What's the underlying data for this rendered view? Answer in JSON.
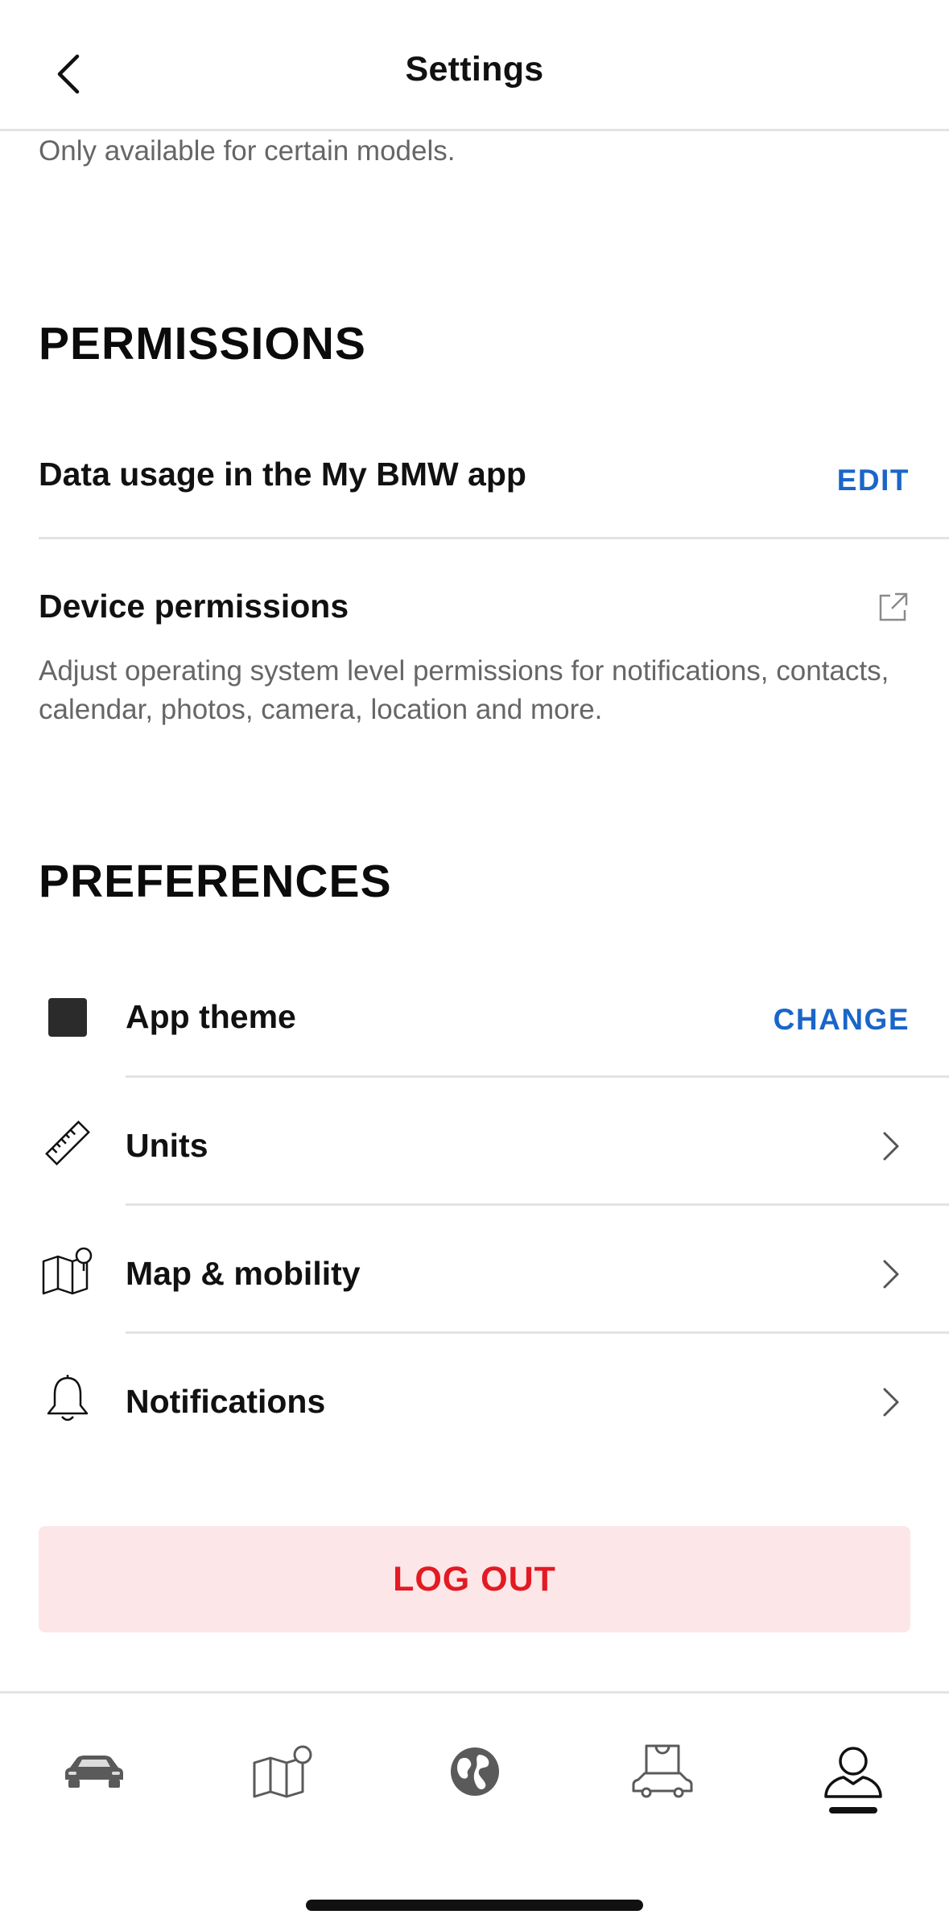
{
  "header": {
    "title": "Settings",
    "back_icon": "chevron-left-icon"
  },
  "note_text": "Only available for certain models.",
  "permissions": {
    "heading": "PERMISSIONS",
    "data_usage": {
      "title": "Data usage in the My BMW app",
      "action": "EDIT"
    },
    "device_permissions": {
      "title": "Device permissions",
      "description": "Adjust operating system level permissions for notifications, contacts, calendar, photos, camera, location and more.",
      "icon": "external-link-icon"
    }
  },
  "preferences": {
    "heading": "PREFERENCES",
    "items": [
      {
        "icon": "theme-swatch-icon",
        "label": "App theme",
        "action": "CHANGE"
      },
      {
        "icon": "ruler-icon",
        "label": "Units",
        "trailing_icon": "chevron-right-icon"
      },
      {
        "icon": "map-pin-icon",
        "label": "Map & mobility",
        "trailing_icon": "chevron-right-icon"
      },
      {
        "icon": "bell-icon",
        "label": "Notifications",
        "trailing_icon": "chevron-right-icon"
      }
    ]
  },
  "logout_label": "LOG OUT",
  "tabbar": {
    "tabs": [
      {
        "name": "vehicle",
        "icon": "car-icon"
      },
      {
        "name": "map",
        "icon": "map-icon"
      },
      {
        "name": "discover",
        "icon": "globe-icon"
      },
      {
        "name": "shop",
        "icon": "shopping-bag-car-icon"
      },
      {
        "name": "profile",
        "icon": "profile-icon",
        "active": true
      }
    ]
  },
  "colors": {
    "accent": "#1a66c8",
    "logout_text": "#e31a23",
    "logout_bg": "#fce6e7",
    "divider": "#e3e3e3",
    "muted_text": "#666666"
  }
}
